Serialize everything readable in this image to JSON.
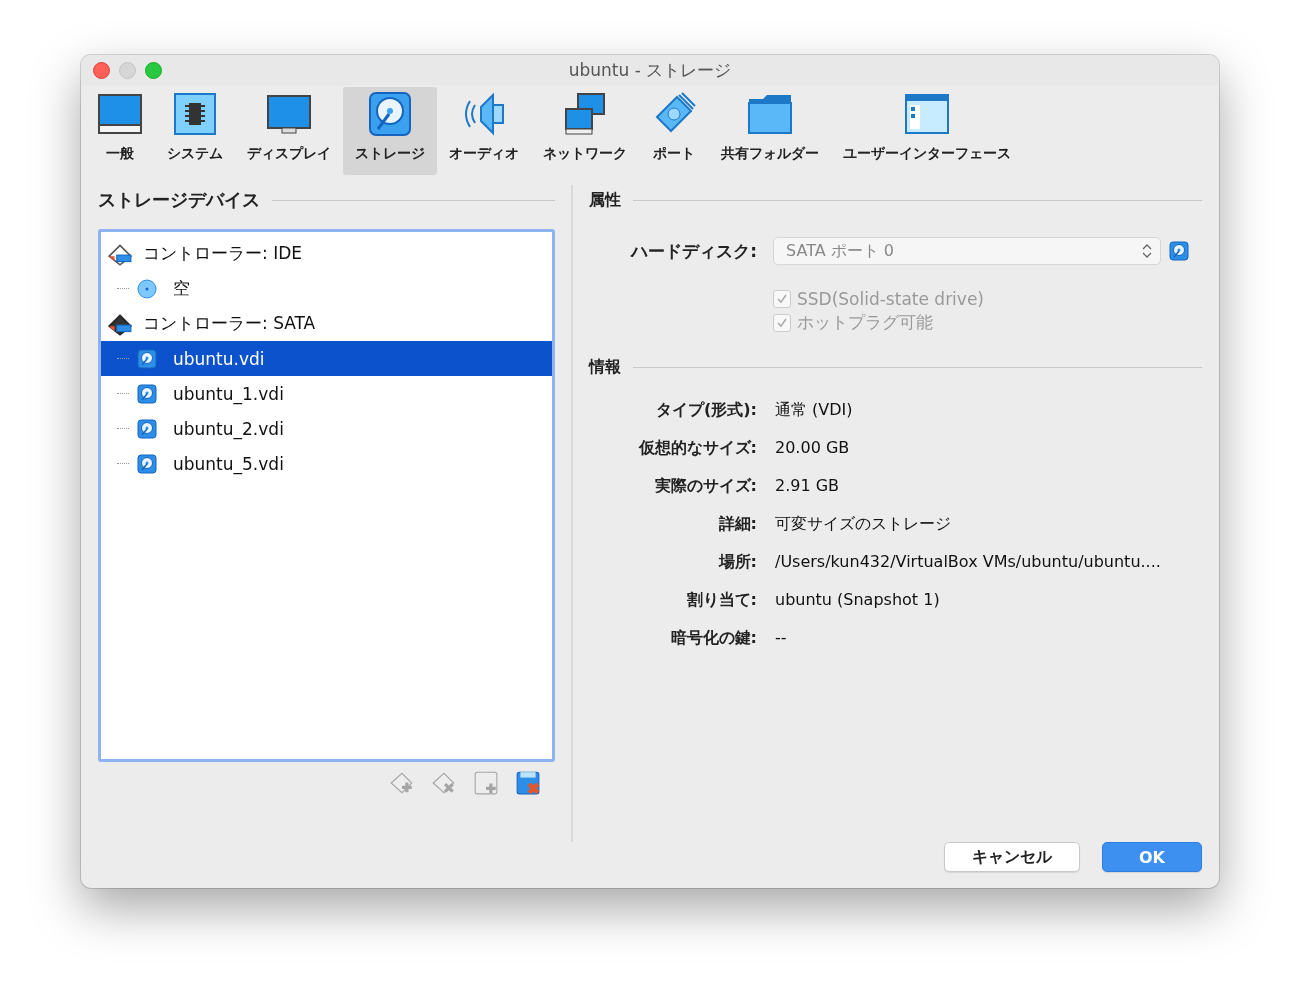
{
  "window": {
    "title": "ubuntu - ストレージ"
  },
  "tabs": [
    {
      "label": "一般",
      "kind": "general",
      "selected": false
    },
    {
      "label": "システム",
      "kind": "system",
      "selected": false
    },
    {
      "label": "ディスプレイ",
      "kind": "display",
      "selected": false
    },
    {
      "label": "ストレージ",
      "kind": "storage",
      "selected": true
    },
    {
      "label": "オーディオ",
      "kind": "audio",
      "selected": false
    },
    {
      "label": "ネットワーク",
      "kind": "network",
      "selected": false
    },
    {
      "label": "ポート",
      "kind": "port",
      "selected": false
    },
    {
      "label": "共有フォルダー",
      "kind": "folder",
      "selected": false
    },
    {
      "label": "ユーザーインターフェース",
      "kind": "ui",
      "selected": false
    }
  ],
  "storage": {
    "title": "ストレージデバイス",
    "controllers": [
      {
        "label": "コントローラー: IDE",
        "kind": "ide",
        "children": [
          {
            "label": "空",
            "kind": "optical",
            "selected": false
          }
        ]
      },
      {
        "label": "コントローラー: SATA",
        "kind": "sata",
        "children": [
          {
            "label": "ubuntu.vdi",
            "kind": "disk",
            "selected": true
          },
          {
            "label": "ubuntu_1.vdi",
            "kind": "disk",
            "selected": false
          },
          {
            "label": "ubuntu_2.vdi",
            "kind": "disk",
            "selected": false
          },
          {
            "label": "ubuntu_5.vdi",
            "kind": "disk",
            "selected": false
          }
        ]
      }
    ],
    "tools": [
      {
        "kind": "add-controller",
        "disabled": true
      },
      {
        "kind": "remove-controller",
        "disabled": true
      },
      {
        "kind": "add-attachment",
        "disabled": true
      },
      {
        "kind": "remove-attachment",
        "disabled": false
      }
    ]
  },
  "attributes": {
    "title": "属性",
    "hard_disk_label": "ハードディスク:",
    "hard_disk_value": "SATA ポート 0",
    "checkboxes": [
      {
        "label": "SSD(Solid-state drive)",
        "checked": true,
        "disabled": true
      },
      {
        "label": "ホットプラグ可能",
        "checked": true,
        "disabled": true
      }
    ]
  },
  "info": {
    "title": "情報",
    "rows": [
      {
        "label": "タイプ(形式):",
        "value": "通常 (VDI)"
      },
      {
        "label": "仮想的なサイズ:",
        "value": "20.00 GB"
      },
      {
        "label": "実際のサイズ:",
        "value": "2.91 GB"
      },
      {
        "label": "詳細:",
        "value": "可変サイズのストレージ"
      },
      {
        "label": "場所:",
        "value": "/Users/kun432/VirtualBox VMs/ubuntu/ubuntu...."
      },
      {
        "label": "割り当て:",
        "value": "ubuntu (Snapshot 1)"
      },
      {
        "label": "暗号化の鍵:",
        "value": "--"
      }
    ]
  },
  "buttons": [
    {
      "label": "キャンセル",
      "kind": "secondary"
    },
    {
      "label": "OK",
      "kind": "primary"
    }
  ]
}
